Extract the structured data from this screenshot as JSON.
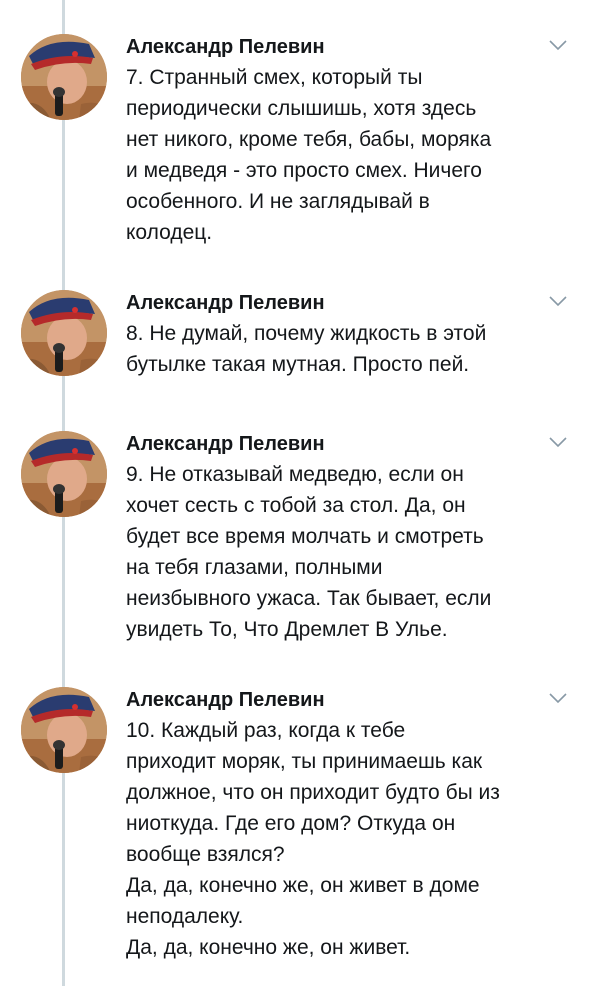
{
  "tweets": [
    {
      "author": "Александр Пелевин",
      "avatar_icon": "user-avatar-icon",
      "menu_icon": "chevron-down-icon",
      "lines": [
        "7. Странный смех, который ты",
        "периодически слышишь, хотя здесь",
        "нет никого, кроме тебя, бабы, моряка",
        "и медведя - это просто смех. Ничего",
        "особенного. И не заглядывай в",
        "колодец."
      ]
    },
    {
      "author": "Александр Пелевин",
      "avatar_icon": "user-avatar-icon",
      "menu_icon": "chevron-down-icon",
      "lines": [
        "8. Не думай, почему жидкость в этой",
        "бутылке такая мутная. Просто пей."
      ]
    },
    {
      "author": "Александр Пелевин",
      "avatar_icon": "user-avatar-icon",
      "menu_icon": "chevron-down-icon",
      "lines": [
        "9. Не отказывай медведю, если он",
        "хочет сесть с тобой за стол. Да, он",
        "будет все время молчать и смотреть",
        "на тебя глазами, полными",
        "неизбывного ужаса. Так бывает, если",
        "увидеть То, Что Дремлет В Улье."
      ]
    },
    {
      "author": "Александр Пелевин",
      "avatar_icon": "user-avatar-icon",
      "menu_icon": "chevron-down-icon",
      "lines": [
        "10. Каждый раз, когда к тебе",
        "приходит моряк, ты принимаешь как",
        "должное, что он приходит будто бы из",
        "ниоткуда. Где его дом? Откуда он",
        "вообще взялся?",
        "Да, да, конечно же, он живет в доме",
        "неподалеку.",
        "Да, да, конечно же, он живет."
      ]
    }
  ]
}
